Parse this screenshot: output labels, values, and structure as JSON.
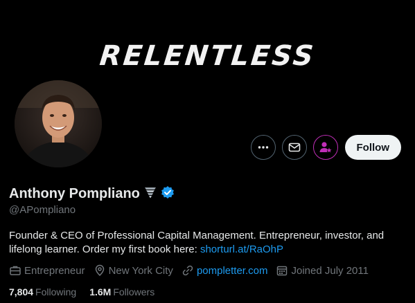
{
  "banner": {
    "text": "RELENTLESS"
  },
  "profile": {
    "name": "Anthony Pompliano",
    "handle": "@APompliano",
    "bio_text": "Founder & CEO of Professional Capital Management. Entrepreneur, investor, and lifelong learner. Order my first book here: ",
    "bio_link": "shorturl.at/RaOhP",
    "verified_color": "#1d9bf0"
  },
  "actions": {
    "more_icon": "more-horizontal-icon",
    "message_icon": "mail-icon",
    "subscribe_icon": "subscribe-person-star-icon",
    "follow_label": "Follow"
  },
  "meta": {
    "category": "Entrepreneur",
    "location": "New York City",
    "website": "pompletter.com",
    "joined": "Joined July 2011"
  },
  "stats": {
    "following_count": "7,804",
    "following_label": "Following",
    "followers_count": "1.6M",
    "followers_label": "Followers"
  }
}
